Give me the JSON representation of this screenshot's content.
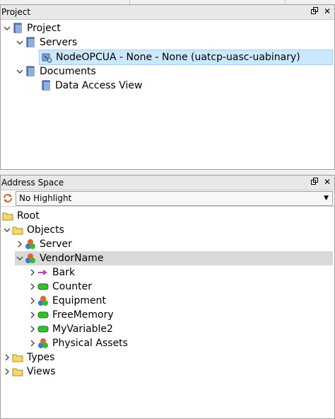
{
  "project_panel": {
    "title": "Project",
    "tree": {
      "root": "Project",
      "servers": "Servers",
      "server_item": "NodeOPCUA - None - None (uatcp-uasc-uabinary)",
      "documents": "Documents",
      "data_access_view": "Data Access View"
    }
  },
  "address_panel": {
    "title": "Address Space",
    "highlight": "No Highlight",
    "tree": {
      "root": "Root",
      "objects": "Objects",
      "server": "Server",
      "vendor": "VendorName",
      "bark": "Bark",
      "counter": "Counter",
      "equipment": "Equipment",
      "freememory": "FreeMemory",
      "myvariable2": "MyVariable2",
      "physical_assets": "Physical Assets",
      "types": "Types",
      "views": "Views"
    }
  },
  "colors": {
    "selection": "#cce8ff",
    "selection_border": "#99d1ff",
    "folder": "#f5d76e",
    "variable": "#2ec02e"
  }
}
